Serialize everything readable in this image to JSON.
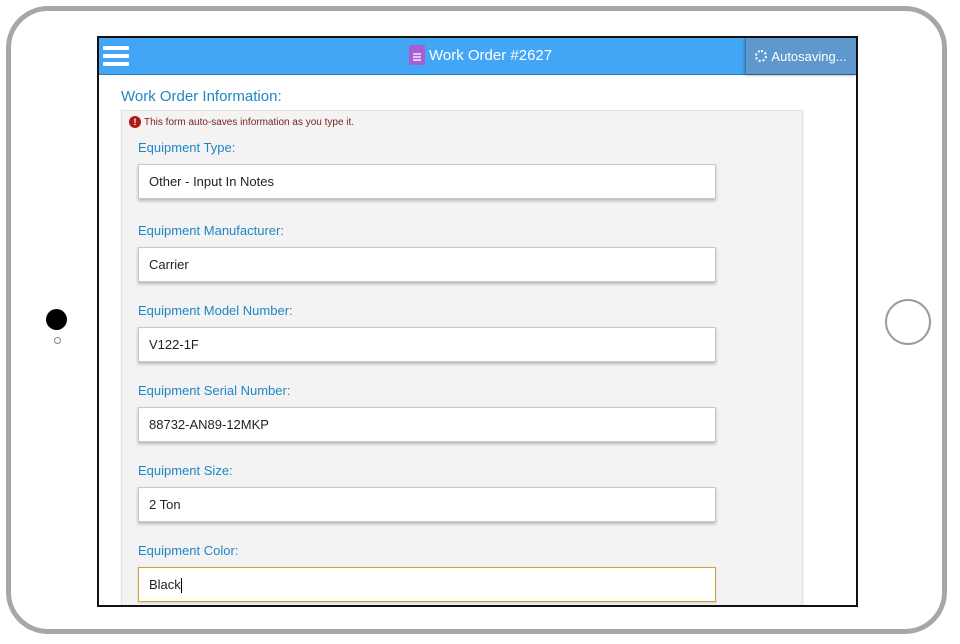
{
  "header": {
    "title": "Work Order #2627",
    "autosave_label": "Autosaving..."
  },
  "section": {
    "heading": "Work Order Information:"
  },
  "notice": {
    "text": "This form auto-saves information as you type it.",
    "icon": "!"
  },
  "fields": {
    "type": {
      "label": "Equipment Type:",
      "value": "Other - Input In Notes"
    },
    "manufacturer": {
      "label": "Equipment Manufacturer:",
      "value": "Carrier"
    },
    "model": {
      "label": "Equipment Model Number:",
      "value": "V122-1F"
    },
    "serial": {
      "label": "Equipment Serial Number:",
      "value": "88732-AN89-12MKP"
    },
    "size": {
      "label": "Equipment Size:",
      "value": "2 Ton"
    },
    "color": {
      "label": "Equipment Color:",
      "value": "Black"
    }
  },
  "colors": {
    "topbar": "#42a5f5",
    "accent_text": "#1f86c5",
    "focus_border": "#d4a03a",
    "error": "#b01919"
  }
}
